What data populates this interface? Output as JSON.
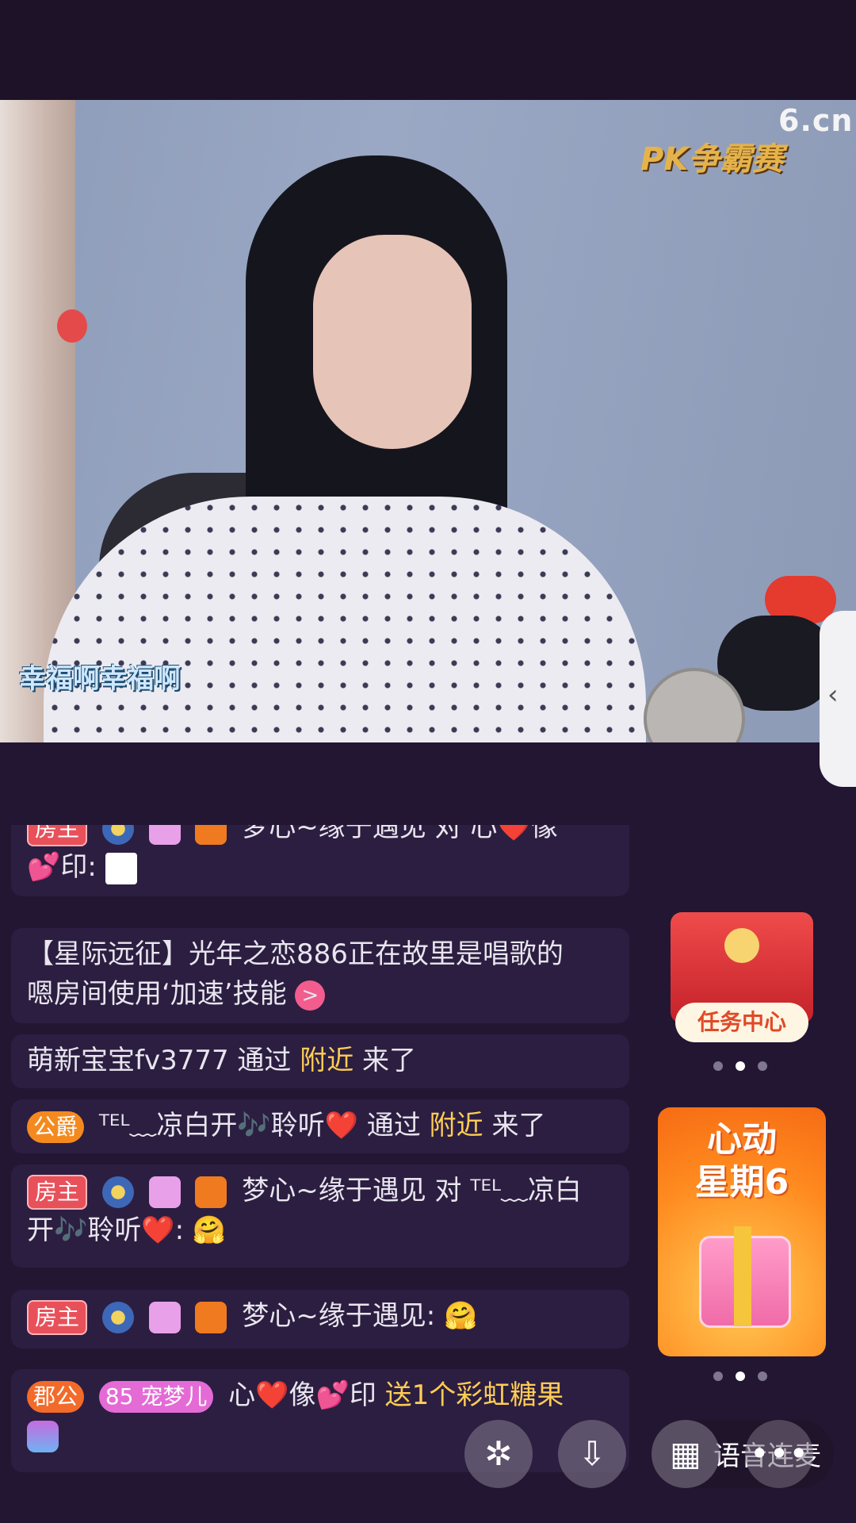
{
  "stream": {
    "site_logo": "6.cn",
    "pk_badge": "PK争霸赛",
    "streamer_name": "幸福啊幸福啊"
  },
  "side_tab_icon": "‹",
  "chat": {
    "messages": [
      {
        "badge": "房主",
        "parts": [
          "梦心~缘于遇见 对 心❤️像"
        ],
        "line2": "💕印:"
      },
      {
        "text1": "【星际远征】光年之恋886正在故里是唱歌的",
        "text2": "嗯房间使用‘加速’技能",
        "arrow": ">"
      },
      {
        "text": "萌新宝宝fv3777 通过 ",
        "hl": "附近",
        "tail": " 来了"
      },
      {
        "badge": "公爵",
        "text": "ᵀᴱᴸ﹏凉白开🎶聆听❤️ 通过 ",
        "hl": "附近",
        "tail": " 来了"
      },
      {
        "badge": "房主",
        "text1": "梦心~缘于遇见 对 ᵀᴱᴸ﹏凉白",
        "text2": "开🎶聆听❤️: 🤗"
      },
      {
        "badge": "房主",
        "text": "梦心~缘于遇见: 🤗"
      },
      {
        "badge": "郡公",
        "pet_badge": "85 宠梦儿",
        "text": "心❤️像💕印 ",
        "hl": "送1个彩虹糖果"
      }
    ]
  },
  "right": {
    "task_center": "任务中心",
    "promo_title_1": "心动",
    "promo_title_2": "星期6"
  },
  "bottom_bar": {
    "share_icon": "share-icon",
    "download_icon": "download-icon",
    "grid_icon": "grid-icon",
    "voice_label": "语音连麦"
  }
}
